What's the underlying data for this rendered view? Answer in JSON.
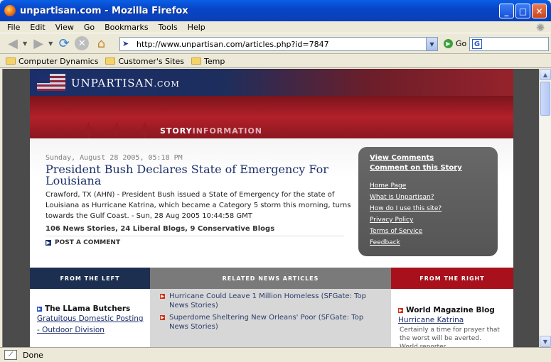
{
  "window": {
    "title": "unpartisan.com - Mozilla Firefox"
  },
  "menu": [
    "File",
    "Edit",
    "View",
    "Go",
    "Bookmarks",
    "Tools",
    "Help"
  ],
  "nav": {
    "url": "http://www.unpartisan.com/articles.php?id=7847",
    "go_label": "Go",
    "search_icon": "G"
  },
  "bookmarks": [
    "Computer Dynamics",
    "Customer's Sites",
    "Temp"
  ],
  "status": {
    "text": "Done"
  },
  "page": {
    "brand": {
      "main": "UNPARTISAN",
      "suffix": ".COM"
    },
    "section_label": {
      "story": "STORY",
      "information": "INFORMATION"
    },
    "story": {
      "date": "Sunday, August 28 2005, 05:18 PM",
      "headline": "President Bush Declares State of Emergency For Louisiana",
      "summary": "Crawford, TX (AHN) - President Bush issued a State of Emergency for the state of Louisiana as Hurricane Katrina, which became a Category 5 storm this morning, turns towards the Gulf Coast. - Sun, 28 Aug 2005 10:44:58 GMT",
      "counts": "106 News Stories, 24 Liberal Blogs, 9 Conservative Blogs",
      "post_comment": "POST A COMMENT"
    },
    "sidebox": {
      "primary": [
        "View Comments",
        "Comment on this Story"
      ],
      "links": [
        "Home Page",
        "What is Unpartisan?",
        "How do I use this site?",
        "Privacy Policy",
        "Terms of Service",
        "Feedback"
      ]
    },
    "columns": {
      "left": {
        "header": "FROM THE LEFT",
        "blog": "The LLama Butchers",
        "link": "Gratuitous Domestic Posting - Outdoor Division"
      },
      "center": {
        "header": "RELATED NEWS ARTICLES",
        "items": [
          "Hurricane Could Leave 1 Million Homeless (SFGate: Top News Stories)",
          "Superdome Sheltering New Orleans' Poor (SFGate: Top News Stories)"
        ]
      },
      "right": {
        "header": "FROM THE RIGHT",
        "blog": "World Magazine Blog",
        "link": "Hurricane Katrina",
        "snippet": "Certainly a time for prayer that the worst will be averted. World reporter"
      }
    }
  }
}
